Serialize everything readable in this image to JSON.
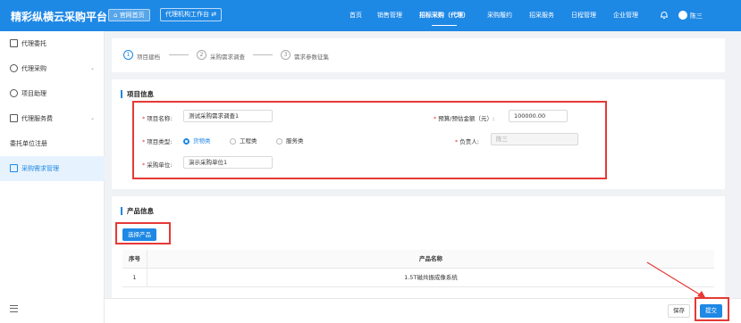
{
  "header": {
    "brand": "精彩纵横云采购平台",
    "home_button": "官网首页",
    "workbench_button": "代理机构工作台 ⇄",
    "nav": [
      "首页",
      "销售管理",
      "招标采购（代理）",
      "采购履约",
      "招采服务",
      "日程管理",
      "企业管理"
    ],
    "active_nav": "招标采购（代理）",
    "user_name": "陈三"
  },
  "sidebar": {
    "items": [
      {
        "label": "代理委托",
        "icon": "document-icon"
      },
      {
        "label": "代理采购",
        "icon": "user-icon"
      },
      {
        "label": "项目助理",
        "icon": "user-icon"
      },
      {
        "label": "代理服务费",
        "icon": "fee-icon"
      },
      {
        "label": "委托单位注册",
        "icon": ""
      },
      {
        "label": "采购需求管理",
        "icon": "form-icon"
      }
    ],
    "active": "采购需求管理"
  },
  "steps": [
    {
      "num": "1",
      "label": "项目建档"
    },
    {
      "num": "2",
      "label": "采购需求调查"
    },
    {
      "num": "3",
      "label": "需求参数征集"
    }
  ],
  "project_info": {
    "section_title": "项目信息",
    "project_name_label": "项目名称:",
    "project_name_value": "测试采购需求调查1",
    "budget_label": "预算/预估金额（元）:",
    "budget_value": "100000.00",
    "project_type_label": "项目类型:",
    "type_options": [
      "货物类",
      "工程类",
      "服务类"
    ],
    "type_selected": "货物类",
    "owner_label": "负责人:",
    "owner_value": "陈三",
    "purchaser_label": "采购单位:",
    "purchaser_value": "演示采购单位1"
  },
  "products": {
    "section_title": "产品信息",
    "select_button": "选择产品",
    "columns": [
      "序号",
      "产品名称"
    ],
    "rows": [
      {
        "index": "1",
        "name": "1.5T磁共振成像系统"
      }
    ]
  },
  "footer": {
    "save_label": "保存",
    "submit_label": "提交"
  },
  "colors": {
    "primary": "#1e88e5",
    "highlight": "#e53935"
  }
}
